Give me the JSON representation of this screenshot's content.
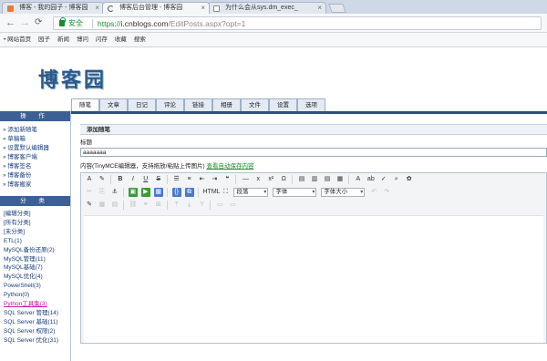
{
  "browser": {
    "tabs": [
      {
        "title": "博客 - 我的园子 - 博客园",
        "active": false
      },
      {
        "title": "博客后台管理 - 博客园",
        "active": true
      },
      {
        "title": "为什么会从sys.dm_exec_",
        "active": false
      }
    ],
    "tab_close": "×",
    "url_secure": "安全",
    "url_scheme": "https://",
    "url_host": "i.cnblogs.com",
    "url_path": "/EditPosts.aspx?opt=1",
    "bookmarks": [
      "网站首页",
      "园子",
      "新闻",
      "博问",
      "闪存",
      "收藏",
      "搜索"
    ]
  },
  "page": {
    "logo": "博客园",
    "admin_tabs": [
      "随笔",
      "文章",
      "日记",
      "评论",
      "链接",
      "相册",
      "文件",
      "设置",
      "选项"
    ],
    "sidebar": {
      "ops_title": "操 作",
      "ops": [
        "添加新随笔",
        "草稿箱",
        "设置默认编辑器",
        "博客客户端",
        "博客签名",
        "博客备份",
        "博客搬家"
      ],
      "cats_title": "分 类",
      "cats": [
        "[编辑分类]",
        "[所有分类]",
        "[未分类]",
        "ETL(1)",
        "MySQL备份还原(2)",
        "MySQL管理(11)",
        "MySQL基础(7)",
        "MySQL优化(4)",
        "PowerShell(3)",
        "Python(0)",
        "Python工具集(3)",
        "SQL Server 管理(14)",
        "SQL Server 基础(11)",
        "SQL Server 权限(2)",
        "SQL Server 优化(31)"
      ]
    },
    "editor_box": {
      "heading": "添加随笔",
      "title_label": "标题",
      "title_value": "aaaaaaa",
      "content_label": "内容(TinyMCE编辑器，支持拖放/粘贴上传图片)",
      "autosave_link": "查看自动保存内容",
      "paragraph_select": "段落",
      "font_select": "字体",
      "size_select": "字体大小"
    }
  }
}
